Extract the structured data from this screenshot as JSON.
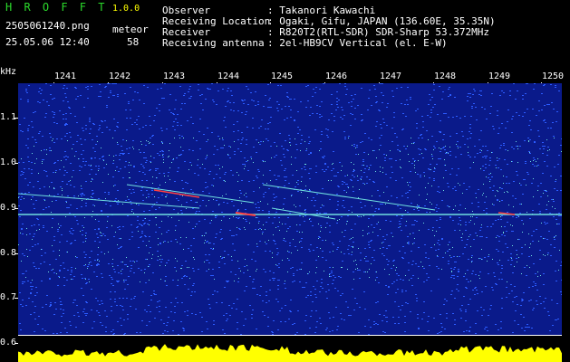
{
  "app": {
    "title": "H R O F F T",
    "version": "1.0.0",
    "filename": "2505061240.png",
    "datetime": "25.05.06 12:40",
    "meteor_label": "meteor",
    "meteor_count": "58"
  },
  "info": {
    "rows": [
      {
        "key": "Observer",
        "value": ": Takanori Kawachi"
      },
      {
        "key": "Receiving Location",
        "value": ": Ogaki, Gifu, JAPAN (136.60E, 35.35N)"
      },
      {
        "key": "Receiver",
        "value": ": R820T2(RTL-SDR) SDR-Sharp 53.372MHz"
      },
      {
        "key": "Receiving antenna",
        "value": ": 2el-HB9CV Vertical (el. E-W)"
      }
    ]
  },
  "axis": {
    "unit": "kHz",
    "y_labels": [
      "1.1",
      "1.0",
      "0.9",
      "0.8",
      "0.7",
      "0.6"
    ],
    "x_labels": [
      "1241",
      "1242",
      "1243",
      "1244",
      "1245",
      "1246",
      "1247",
      "1248",
      "1249",
      "1250"
    ]
  },
  "colors": {
    "background": "#0a1a8a",
    "noise": "#2c5cff",
    "trace": "#6fe0e0",
    "hot": "#ff4040",
    "histogram": "#ffff00",
    "header_green": "#2bd92b"
  }
}
